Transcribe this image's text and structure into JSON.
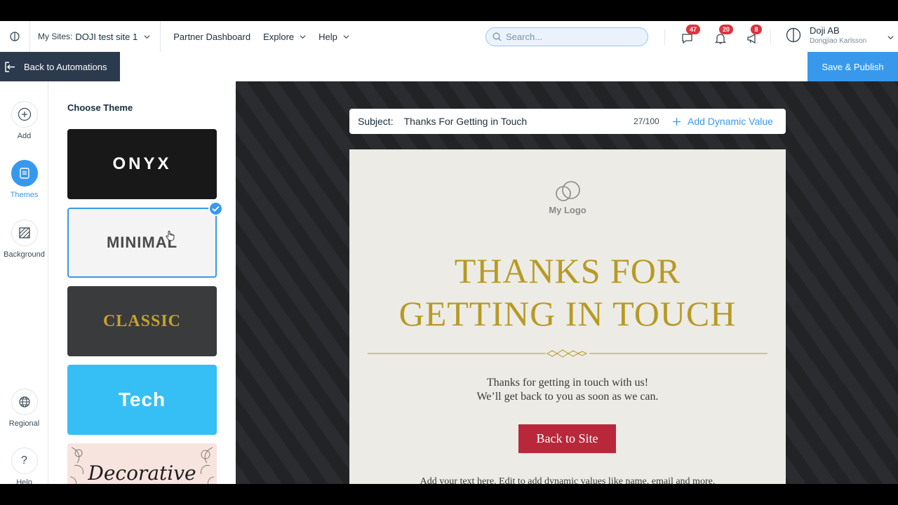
{
  "topbar": {
    "site_prefix": "My Sites:",
    "site_name": "DOJI test site 1",
    "nav": [
      "Partner Dashboard",
      "Explore",
      "Help"
    ],
    "search_placeholder": "Search...",
    "notifications": {
      "messages": "47",
      "alerts": "20",
      "updates": "8"
    },
    "account_name": "Doji AB",
    "account_user": "Dongjiao Karlsson"
  },
  "subbar": {
    "back_label": "Back to Automations",
    "publish_label": "Save & Publish"
  },
  "rail": {
    "items": [
      {
        "label": "Add",
        "icon": "plus-circle-icon"
      },
      {
        "label": "Themes",
        "icon": "themes-icon"
      },
      {
        "label": "Background",
        "icon": "background-icon"
      },
      {
        "label": "Regional",
        "icon": "globe-icon"
      },
      {
        "label": "Help",
        "icon": "question-icon"
      }
    ]
  },
  "panel": {
    "title": "Choose Theme",
    "themes": [
      "ONYX",
      "MINIMAL",
      "CLASSIC",
      "Tech",
      "Decorative"
    ],
    "selected": "MINIMAL"
  },
  "editor": {
    "subject_label": "Subject:",
    "subject_value": "Thanks For Getting in Touch",
    "subject_count": "27/100",
    "dynamic_label": "Add Dynamic Value"
  },
  "email": {
    "logo_text": "My Logo",
    "headline_line1": "THANKS FOR",
    "headline_line2": "GETTING IN TOUCH",
    "body_line1": "Thanks for getting in touch with us!",
    "body_line2": "We’ll get back to you as soon as we can.",
    "cta_label": "Back to Site",
    "footer_text": "Add your text here. Edit to add dynamic values like name, email and more."
  },
  "colors": {
    "accent": "#3899ec",
    "headline_gold": "#b79a25",
    "cta_red": "#b8283a",
    "email_bg": "#ecebe5"
  }
}
